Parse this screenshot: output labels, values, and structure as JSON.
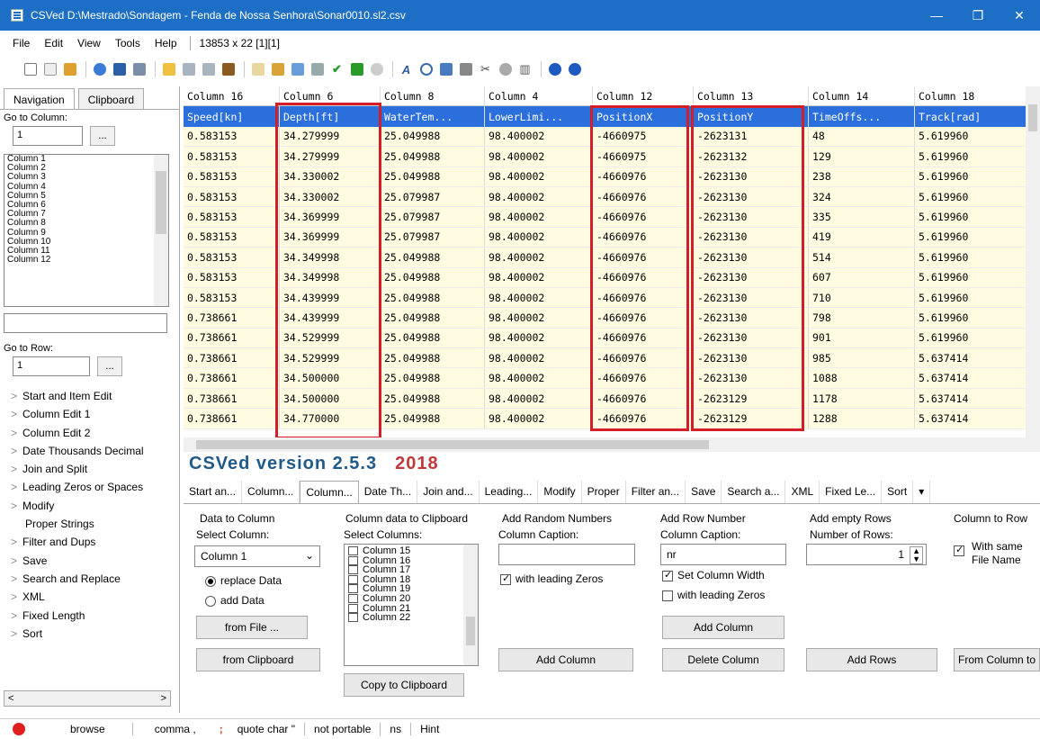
{
  "window": {
    "title": "CSVed D:\\Mestrado\\Sondagem - Fenda de Nossa Senhora\\Sonar0010.sl2.csv",
    "minimize": "—",
    "restore": "❐",
    "close": "✕"
  },
  "menu": {
    "items": [
      "File",
      "Edit",
      "View",
      "Tools",
      "Help"
    ],
    "info": "13853 x 22 [1][1]"
  },
  "toolbar_icons": [
    "new-icon",
    "copy-icon",
    "open-icon",
    "refresh-icon",
    "save-icon",
    "save-as-icon",
    "folder-icon",
    "undo-icon",
    "redo-icon",
    "book-icon",
    "search-disabled-icon",
    "paste-icon",
    "image-icon",
    "calendar-icon",
    "check-icon",
    "check-box-icon",
    "disabled-icon",
    "font-icon",
    "zoom-icon",
    "table-icon",
    "doc-icon",
    "cut-icon",
    "settings-icon",
    "columns-icon",
    "help-icon",
    "info-icon"
  ],
  "sidebar": {
    "tabs": [
      "Navigation",
      "Clipboard"
    ],
    "goto_column_label": "Go to Column:",
    "goto_column_value": "1",
    "btn_dots": "...",
    "columns": [
      "Column 1",
      "Column 2",
      "Column 3",
      "Column 4",
      "Column 5",
      "Column 6",
      "Column 7",
      "Column 8",
      "Column 9",
      "Column 10",
      "Column 11",
      "Column 12"
    ],
    "goto_row_label": "Go to Row:",
    "goto_row_value": "1",
    "tree": [
      "Start and Item Edit",
      "Column Edit 1",
      "Column Edit 2",
      "Date Thousands Decimal",
      "Join and Split",
      "Leading Zeros or Spaces",
      "Modify",
      "Proper Strings",
      "Filter and Dups",
      "Save",
      "Search and Replace",
      "XML",
      "Fixed Length",
      "Sort"
    ],
    "scroll_left": "<",
    "scroll_right": ">"
  },
  "grid": {
    "headers": [
      "Column 16",
      "Column 6",
      "Column 8",
      "Column 4",
      "Column 12",
      "Column 13",
      "Column 14",
      "Column 18"
    ],
    "selected_row": [
      "Speed[kn]",
      "Depth[ft]",
      "WaterTem...",
      "LowerLimi...",
      "PositionX",
      "PositionY",
      "TimeOffs...",
      "Track[rad]"
    ],
    "rows": [
      [
        "0.583153",
        "34.279999",
        "25.049988",
        "98.400002",
        "-4660975",
        "-2623131",
        "48",
        "5.619960"
      ],
      [
        "0.583153",
        "34.279999",
        "25.049988",
        "98.400002",
        "-4660975",
        "-2623132",
        "129",
        "5.619960"
      ],
      [
        "0.583153",
        "34.330002",
        "25.049988",
        "98.400002",
        "-4660976",
        "-2623130",
        "238",
        "5.619960"
      ],
      [
        "0.583153",
        "34.330002",
        "25.079987",
        "98.400002",
        "-4660976",
        "-2623130",
        "324",
        "5.619960"
      ],
      [
        "0.583153",
        "34.369999",
        "25.079987",
        "98.400002",
        "-4660976",
        "-2623130",
        "335",
        "5.619960"
      ],
      [
        "0.583153",
        "34.369999",
        "25.079987",
        "98.400002",
        "-4660976",
        "-2623130",
        "419",
        "5.619960"
      ],
      [
        "0.583153",
        "34.349998",
        "25.049988",
        "98.400002",
        "-4660976",
        "-2623130",
        "514",
        "5.619960"
      ],
      [
        "0.583153",
        "34.349998",
        "25.049988",
        "98.400002",
        "-4660976",
        "-2623130",
        "607",
        "5.619960"
      ],
      [
        "0.583153",
        "34.439999",
        "25.049988",
        "98.400002",
        "-4660976",
        "-2623130",
        "710",
        "5.619960"
      ],
      [
        "0.738661",
        "34.439999",
        "25.049988",
        "98.400002",
        "-4660976",
        "-2623130",
        "798",
        "5.619960"
      ],
      [
        "0.738661",
        "34.529999",
        "25.049988",
        "98.400002",
        "-4660976",
        "-2623130",
        "901",
        "5.619960"
      ],
      [
        "0.738661",
        "34.529999",
        "25.049988",
        "98.400002",
        "-4660976",
        "-2623130",
        "985",
        "5.637414"
      ],
      [
        "0.738661",
        "34.500000",
        "25.049988",
        "98.400002",
        "-4660976",
        "-2623130",
        "1088",
        "5.637414"
      ],
      [
        "0.738661",
        "34.500000",
        "25.049988",
        "98.400002",
        "-4660976",
        "-2623129",
        "1178",
        "5.637414"
      ],
      [
        "0.738661",
        "34.770000",
        "25.049988",
        "98.400002",
        "-4660976",
        "-2623129",
        "1288",
        "5.637414"
      ]
    ]
  },
  "version": {
    "text": "CSVed version 2.5.3",
    "year": "2018"
  },
  "tabs": [
    "Start an...",
    "Column...",
    "Column...",
    "Date Th...",
    "Join and...",
    "Leading...",
    "Modify",
    "Proper",
    "Filter an...",
    "Save",
    "Search a...",
    "XML",
    "Fixed Le...",
    "Sort"
  ],
  "tabs_more": "▾",
  "panel": {
    "data_to_column": {
      "title": "Data to Column",
      "select_label": "Select Column:",
      "select_value": "Column 1",
      "replace": "replace Data",
      "add": "add Data",
      "from_file": "from File ...",
      "from_clipboard": "from Clipboard"
    },
    "column_to_clipboard": {
      "title": "Column data to Clipboard",
      "select_label": "Select Columns:",
      "columns": [
        "Column 15",
        "Column 16",
        "Column 17",
        "Column 18",
        "Column 19",
        "Column 20",
        "Column 21",
        "Column 22"
      ],
      "copy": "Copy to Clipboard"
    },
    "random_numbers": {
      "title": "Add Random Numbers",
      "caption_label": "Column Caption:",
      "caption_value": "",
      "leading_zeros": "with leading Zeros",
      "add": "Add Column"
    },
    "row_number": {
      "title": "Add Row Number",
      "caption_label": "Column Caption:",
      "caption_value": "nr",
      "set_width": "Set Column Width",
      "leading_zeros": "with leading Zeros",
      "add": "Add Column",
      "delete": "Delete Column"
    },
    "empty_rows": {
      "title": "Add empty Rows",
      "count_label": "Number of Rows:",
      "count_value": "1",
      "add": "Add Rows"
    },
    "column_to_row": {
      "title": "Column to Row",
      "same_file_1": "With same",
      "same_file_2": "File Name",
      "from": "From Column to"
    }
  },
  "status": {
    "browse": "browse",
    "sep": "comma ,",
    "quote": "quote char \"",
    "portable": "not portable",
    "ns": "ns",
    "hint": "Hint",
    "semicolon": ";"
  }
}
